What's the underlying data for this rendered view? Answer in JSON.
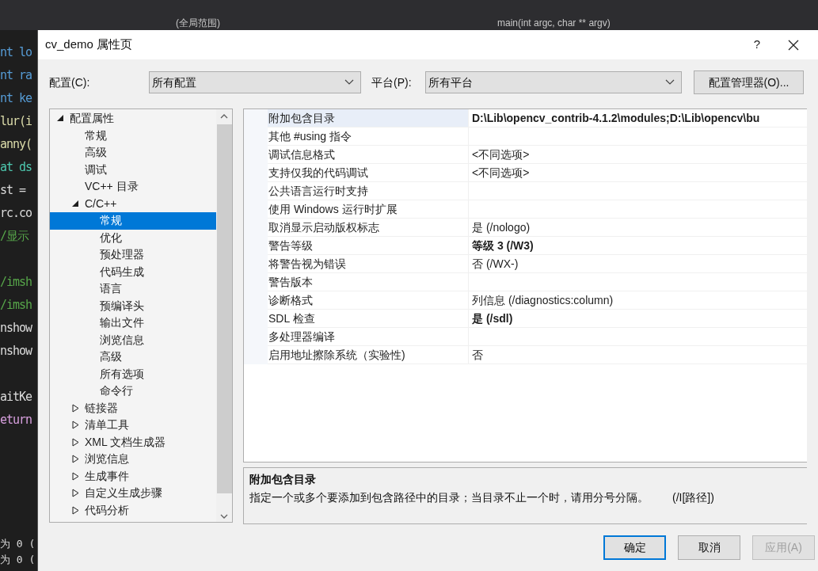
{
  "editor": {
    "scope_label": "(全局范围)",
    "function_label": "main(int argc, char ** argv)",
    "code_blocks": [
      [
        {
          "text": "nt lo",
          "color": "#569cd6"
        },
        {
          "text": "nt ra",
          "color": "#569cd6"
        },
        {
          "text": "nt ke",
          "color": "#569cd6"
        },
        {
          "text": "lur(i",
          "color": "#dcdcaa"
        },
        {
          "text": "anny(",
          "color": "#dcdcaa"
        },
        {
          "text": "at ds",
          "color": "#4ec9b0"
        },
        {
          "text": "st =",
          "color": "#dcdcdc"
        },
        {
          "text": "rc.co",
          "color": "#dcdcdc"
        },
        {
          "text": "/显示",
          "color": "#57a64a"
        }
      ],
      [
        {
          "text": "/imsh",
          "color": "#57a64a"
        },
        {
          "text": "/imsh",
          "color": "#57a64a"
        },
        {
          "text": "nshow",
          "color": "#dcdcdc"
        },
        {
          "text": "nshow",
          "color": "#dcdcdc"
        }
      ],
      [
        {
          "text": "aitKe",
          "color": "#dcdcdc"
        },
        {
          "text": "eturn",
          "color": "#d8a0df"
        }
      ]
    ],
    "output_lines": [
      "为 0 (",
      "为 0 ("
    ]
  },
  "window": {
    "title": "cv_demo 属性页",
    "help": "?"
  },
  "config": {
    "label": "配置(C):",
    "value": "所有配置"
  },
  "platform": {
    "label": "平台(P):",
    "value": "所有平台"
  },
  "manager_button": "配置管理器(O)...",
  "tree": [
    {
      "label": "配置属性",
      "expanded": true,
      "selected": false,
      "children": [
        {
          "label": "常规",
          "selected": false
        },
        {
          "label": "高级",
          "selected": false
        },
        {
          "label": "调试",
          "selected": false
        },
        {
          "label": "VC++ 目录",
          "selected": false
        },
        {
          "label": "C/C++",
          "expanded": true,
          "selected": false,
          "children": [
            {
              "label": "常规",
              "selected": true
            },
            {
              "label": "优化",
              "selected": false
            },
            {
              "label": "预处理器",
              "selected": false
            },
            {
              "label": "代码生成",
              "selected": false
            },
            {
              "label": "语言",
              "selected": false
            },
            {
              "label": "预编译头",
              "selected": false
            },
            {
              "label": "输出文件",
              "selected": false
            },
            {
              "label": "浏览信息",
              "selected": false
            },
            {
              "label": "高级",
              "selected": false
            },
            {
              "label": "所有选项",
              "selected": false
            },
            {
              "label": "命令行",
              "selected": false
            }
          ]
        },
        {
          "label": "链接器",
          "expanded": false,
          "selected": false
        },
        {
          "label": "清单工具",
          "expanded": false,
          "selected": false
        },
        {
          "label": "XML 文档生成器",
          "expanded": false,
          "selected": false
        },
        {
          "label": "浏览信息",
          "expanded": false,
          "selected": false
        },
        {
          "label": "生成事件",
          "expanded": false,
          "selected": false
        },
        {
          "label": "自定义生成步骤",
          "expanded": false,
          "selected": false
        },
        {
          "label": "代码分析",
          "expanded": false,
          "selected": false
        }
      ]
    }
  ],
  "properties": [
    {
      "name": "附加包含目录",
      "value": "D:\\Lib\\opencv_contrib-4.1.2\\modules;D:\\Lib\\opencv\\bu",
      "bold": true,
      "selected": true
    },
    {
      "name": "其他 #using 指令",
      "selected": false
    },
    {
      "name": "调试信息格式",
      "value": "<不同选项>",
      "bold": false,
      "selected": false
    },
    {
      "name": "支持仅我的代码调试",
      "value": "<不同选项>",
      "bold": false,
      "selected": false
    },
    {
      "name": "公共语言运行时支持",
      "selected": false
    },
    {
      "name": "使用 Windows 运行时扩展",
      "selected": false
    },
    {
      "name": "取消显示启动版权标志",
      "value": "是 (/nologo)",
      "bold": false,
      "selected": false
    },
    {
      "name": "警告等级",
      "value": "等级 3 (/W3)",
      "bold": true,
      "selected": false
    },
    {
      "name": "将警告视为错误",
      "value": "否 (/WX-)",
      "bold": false,
      "selected": false
    },
    {
      "name": "警告版本",
      "selected": false
    },
    {
      "name": "诊断格式",
      "value": "列信息 (/diagnostics:column)",
      "bold": false,
      "selected": false
    },
    {
      "name": "SDL 检查",
      "value": "是 (/sdl)",
      "bold": true,
      "selected": false
    },
    {
      "name": "多处理器编译",
      "selected": false
    },
    {
      "name": "启用地址擦除系统（实验性)",
      "value": "否",
      "bold": false,
      "selected": false
    }
  ],
  "description": {
    "title": "附加包含目录",
    "text": "指定一个或多个要添加到包含路径中的目录；当目录不止一个时，请用分号分隔。",
    "switch": "(/I[路径])"
  },
  "buttons": [
    {
      "label": "确定",
      "default": true,
      "disabled": false
    },
    {
      "label": "取消",
      "default": false,
      "disabled": false
    },
    {
      "label": "应用(A)",
      "default": false,
      "disabled": true
    }
  ]
}
